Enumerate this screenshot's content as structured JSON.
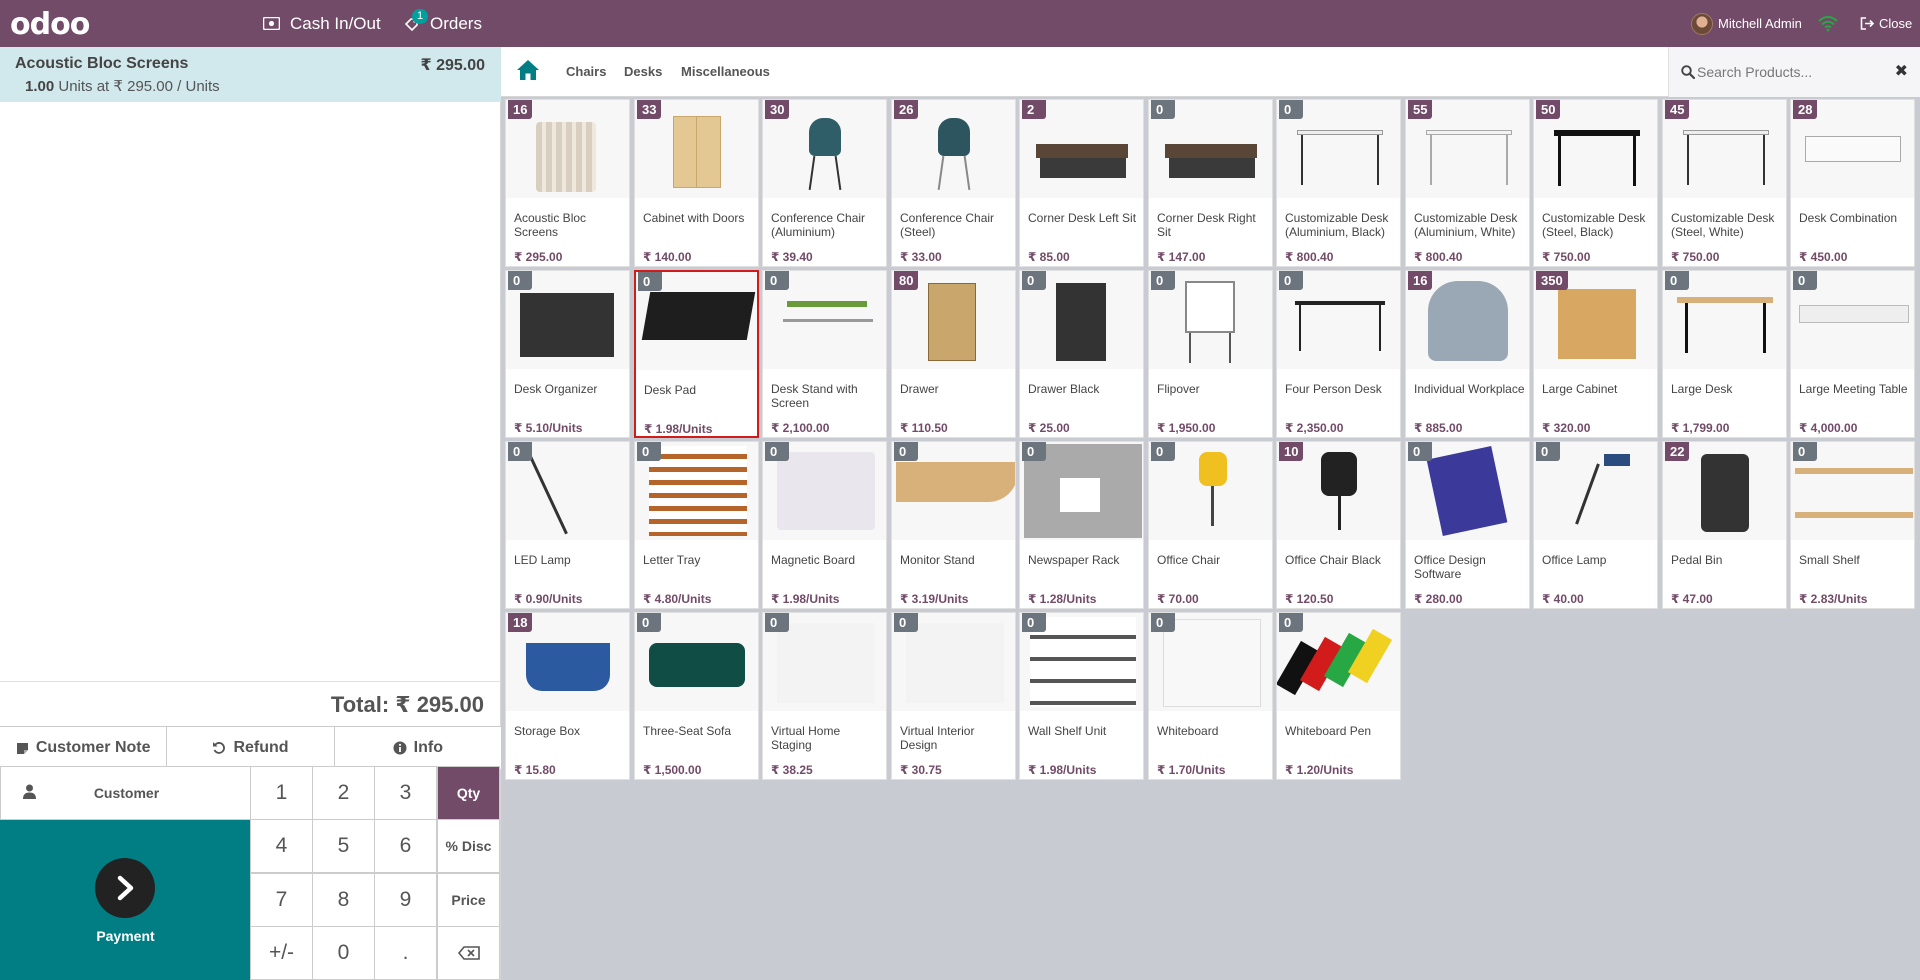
{
  "header": {
    "logo": "odoo",
    "cash_in_out": "Cash In/Out",
    "orders": "Orders",
    "orders_badge": "1",
    "user": "Mitchell Admin",
    "close": "Close"
  },
  "order": {
    "line_name": "Acoustic Bloc Screens",
    "line_price": "₹ 295.00",
    "line_qty": "1.00",
    "line_detail": "Units at ₹ 295.00 / Units",
    "total": "Total: ₹ 295.00"
  },
  "controls": {
    "customer_note": "Customer Note",
    "refund": "Refund",
    "info": "Info",
    "customer": "Customer",
    "payment": "Payment"
  },
  "numpad": [
    "1",
    "2",
    "3",
    "Qty",
    "4",
    "5",
    "6",
    "% Disc",
    "7",
    "8",
    "9",
    "Price",
    "+/-",
    "0",
    ".",
    ""
  ],
  "categories": [
    "Chairs",
    "Desks",
    "Miscellaneous"
  ],
  "search": {
    "placeholder": "Search Products..."
  },
  "products": [
    {
      "name": "Acoustic Bloc Screens",
      "price": "₹ 295.00",
      "qty": "16"
    },
    {
      "name": "Cabinet with Doors",
      "price": "₹ 140.00",
      "qty": "33"
    },
    {
      "name": "Conference Chair (Aluminium)",
      "price": "₹ 39.40",
      "qty": "30"
    },
    {
      "name": "Conference Chair (Steel)",
      "price": "₹ 33.00",
      "qty": "26"
    },
    {
      "name": "Corner Desk Left Sit",
      "price": "₹ 85.00",
      "qty": "2"
    },
    {
      "name": "Corner Desk Right Sit",
      "price": "₹ 147.00",
      "qty": "0"
    },
    {
      "name": "Customizable Desk (Aluminium, Black)",
      "price": "₹ 800.40",
      "qty": "0"
    },
    {
      "name": "Customizable Desk (Aluminium, White)",
      "price": "₹ 800.40",
      "qty": "55"
    },
    {
      "name": "Customizable Desk (Steel, Black)",
      "price": "₹ 750.00",
      "qty": "50"
    },
    {
      "name": "Customizable Desk (Steel, White)",
      "price": "₹ 750.00",
      "qty": "45"
    },
    {
      "name": "Desk Combination",
      "price": "₹ 450.00",
      "qty": "28"
    },
    {
      "name": "Desk Organizer",
      "price": "₹ 5.10/Units",
      "qty": "0"
    },
    {
      "name": "Desk Pad",
      "price": "₹ 1.98/Units",
      "qty": "0"
    },
    {
      "name": "Desk Stand with Screen",
      "price": "₹ 2,100.00",
      "qty": "0"
    },
    {
      "name": "Drawer",
      "price": "₹ 110.50",
      "qty": "80"
    },
    {
      "name": "Drawer Black",
      "price": "₹ 25.00",
      "qty": "0"
    },
    {
      "name": "Flipover",
      "price": "₹ 1,950.00",
      "qty": "0"
    },
    {
      "name": "Four Person Desk",
      "price": "₹ 2,350.00",
      "qty": "0"
    },
    {
      "name": "Individual Workplace",
      "price": "₹ 885.00",
      "qty": "16"
    },
    {
      "name": "Large Cabinet",
      "price": "₹ 320.00",
      "qty": "350"
    },
    {
      "name": "Large Desk",
      "price": "₹ 1,799.00",
      "qty": "0"
    },
    {
      "name": "Large Meeting Table",
      "price": "₹ 4,000.00",
      "qty": "0"
    },
    {
      "name": "LED Lamp",
      "price": "₹ 0.90/Units",
      "qty": "0"
    },
    {
      "name": "Letter Tray",
      "price": "₹ 4.80/Units",
      "qty": "0"
    },
    {
      "name": "Magnetic Board",
      "price": "₹ 1.98/Units",
      "qty": "0"
    },
    {
      "name": "Monitor Stand",
      "price": "₹ 3.19/Units",
      "qty": "0"
    },
    {
      "name": "Newspaper Rack",
      "price": "₹ 1.28/Units",
      "qty": "0"
    },
    {
      "name": "Office Chair",
      "price": "₹ 70.00",
      "qty": "0"
    },
    {
      "name": "Office Chair Black",
      "price": "₹ 120.50",
      "qty": "10"
    },
    {
      "name": "Office Design Software",
      "price": "₹ 280.00",
      "qty": "0"
    },
    {
      "name": "Office Lamp",
      "price": "₹ 40.00",
      "qty": "0"
    },
    {
      "name": "Pedal Bin",
      "price": "₹ 47.00",
      "qty": "22"
    },
    {
      "name": "Small Shelf",
      "price": "₹ 2.83/Units",
      "qty": "0"
    },
    {
      "name": "Storage Box",
      "price": "₹ 15.80",
      "qty": "18"
    },
    {
      "name": "Three-Seat Sofa",
      "price": "₹ 1,500.00",
      "qty": "0"
    },
    {
      "name": "Virtual Home Staging",
      "price": "₹ 38.25",
      "qty": "0"
    },
    {
      "name": "Virtual Interior Design",
      "price": "₹ 30.75",
      "qty": "0"
    },
    {
      "name": "Wall Shelf Unit",
      "price": "₹ 1.98/Units",
      "qty": "0"
    },
    {
      "name": "Whiteboard",
      "price": "₹ 1.70/Units",
      "qty": "0"
    },
    {
      "name": "Whiteboard Pen",
      "price": "₹ 1.20/Units",
      "qty": "0"
    }
  ],
  "selected_product": "Desk Pad",
  "colors": {
    "brand": "#714B67",
    "teal": "#017E84",
    "orderline_bg": "#d1e8ec",
    "selected_border": "#d21b1b"
  }
}
